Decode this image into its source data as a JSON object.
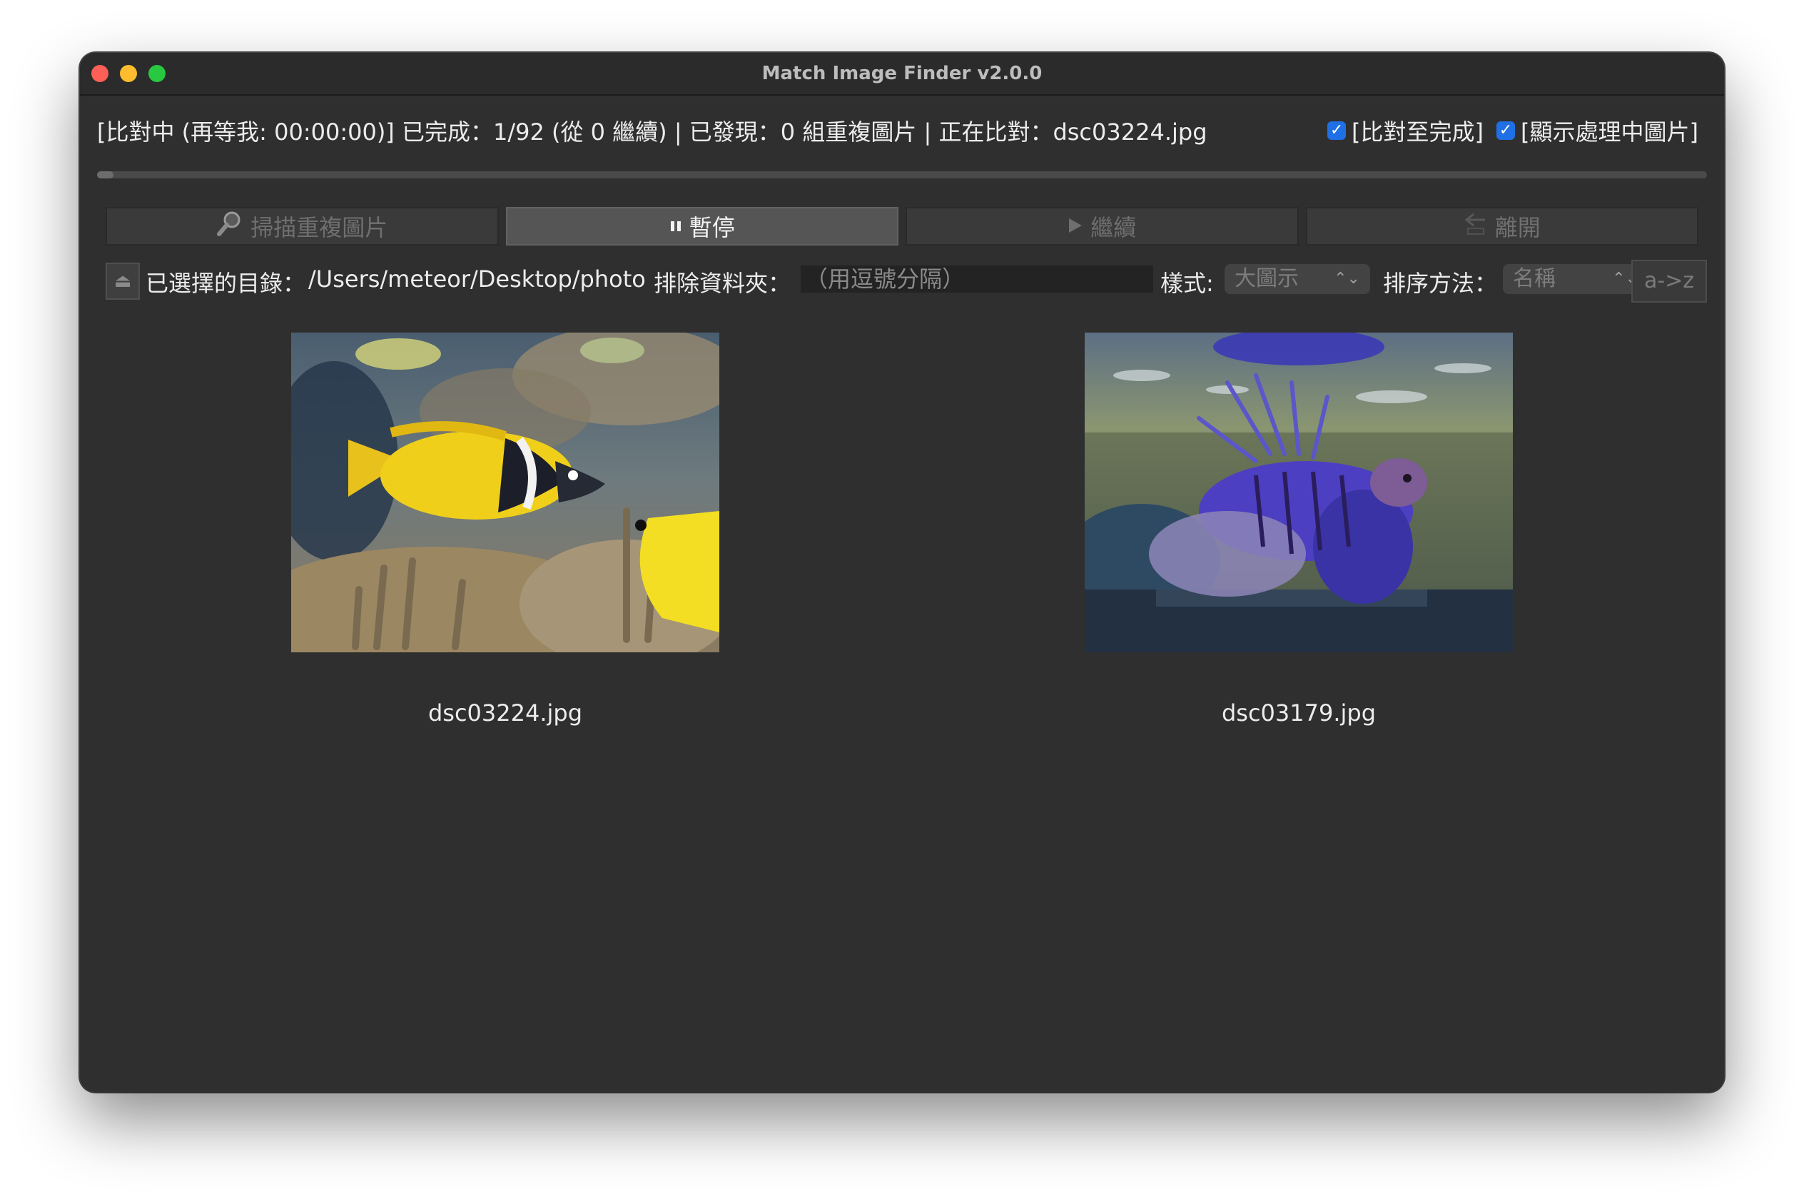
{
  "window": {
    "title": "Match Image Finder v2.0.0"
  },
  "status": {
    "text": "[比對中 (再等我: 00:00:00)] 已完成：1/92 (從 0 繼續) | 已發現：0 組重複圖片 | 正在比對：dsc03224.jpg"
  },
  "options": [
    {
      "label": "[比對至完成]",
      "checked": true
    },
    {
      "label": "[顯示處理中圖片]",
      "checked": true
    }
  ],
  "progress": {
    "value": 0.01
  },
  "toolbar": {
    "scan_label": "掃描重複圖片",
    "pause_label": "暫停",
    "resume_label": "繼續",
    "quit_label": "離開"
  },
  "settings": {
    "dir_label": "已選擇的目錄：",
    "dir_value": "/Users/meteor/Desktop/photo",
    "exclude_label": "排除資料夾：",
    "exclude_placeholder": "（用逗號分隔）",
    "style_label": "樣式:",
    "style_value": "大圖示",
    "sort_label": "排序方法：",
    "sort_value": "名稱",
    "sort_order": "a->z"
  },
  "images": [
    {
      "filename": "dsc03224.jpg",
      "subject": "yellow-rabbitfish-photo"
    },
    {
      "filename": "dsc03179.jpg",
      "subject": "lionfish-photo"
    }
  ]
}
